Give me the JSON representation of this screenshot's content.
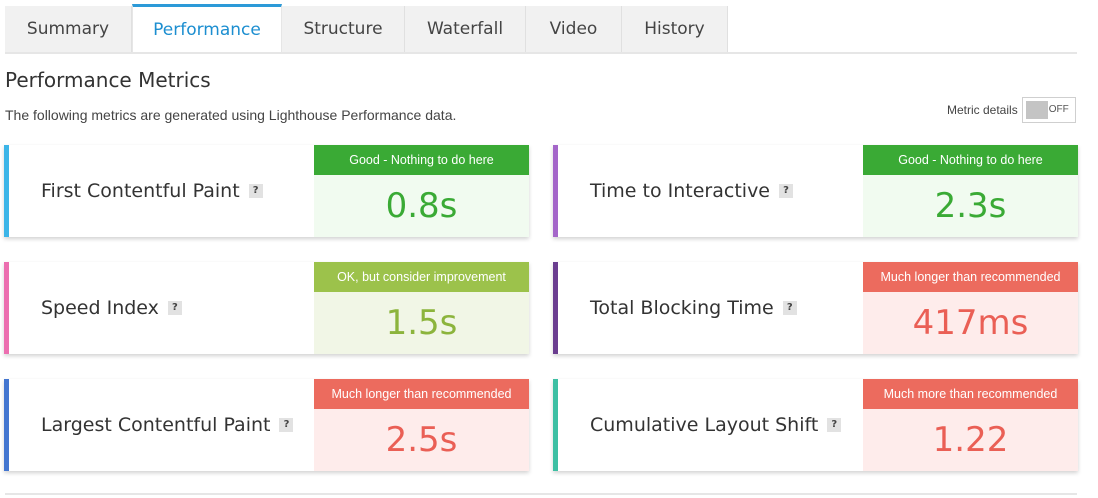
{
  "tabs": [
    "Summary",
    "Performance",
    "Structure",
    "Waterfall",
    "Video",
    "History"
  ],
  "page_title": "Performance Metrics",
  "subtitle": "The following metrics are generated using Lighthouse Performance data.",
  "metric_details": {
    "label": "Metric details",
    "state": "OFF"
  },
  "help_glyph": "?",
  "colors": {
    "good_header": "#3aaa35",
    "good_bg": "#f1fbf0",
    "good_text": "#3aaa35",
    "ok_header": "#9cc24b",
    "ok_bg": "#f1f6e6",
    "ok_text": "#8cb43c",
    "bad_header": "#ec6b5e",
    "bad_bg": "#feeceb",
    "bad_text": "#ea5f55",
    "accent_blue_light": "#3cb5e8",
    "accent_purple": "#a466c9",
    "accent_pink": "#ec6fb0",
    "accent_dark_purple": "#6a3d8f",
    "accent_blue": "#4376d0",
    "accent_teal": "#3dbfa3",
    "tab_active": "#1c8ed0"
  },
  "metrics": {
    "fcp": {
      "name": "First Contentful Paint",
      "status": "Good - Nothing to do here",
      "value": "0.8s"
    },
    "tti": {
      "name": "Time to Interactive",
      "status": "Good - Nothing to do here",
      "value": "2.3s"
    },
    "si": {
      "name": "Speed Index",
      "status": "OK, but consider improvement",
      "value": "1.5s"
    },
    "tbt": {
      "name": "Total Blocking Time",
      "status": "Much longer than recommended",
      "value": "417ms"
    },
    "lcp": {
      "name": "Largest Contentful Paint",
      "status": "Much longer than recommended",
      "value": "2.5s"
    },
    "cls": {
      "name": "Cumulative Layout Shift",
      "status": "Much more than recommended",
      "value": "1.22"
    }
  }
}
